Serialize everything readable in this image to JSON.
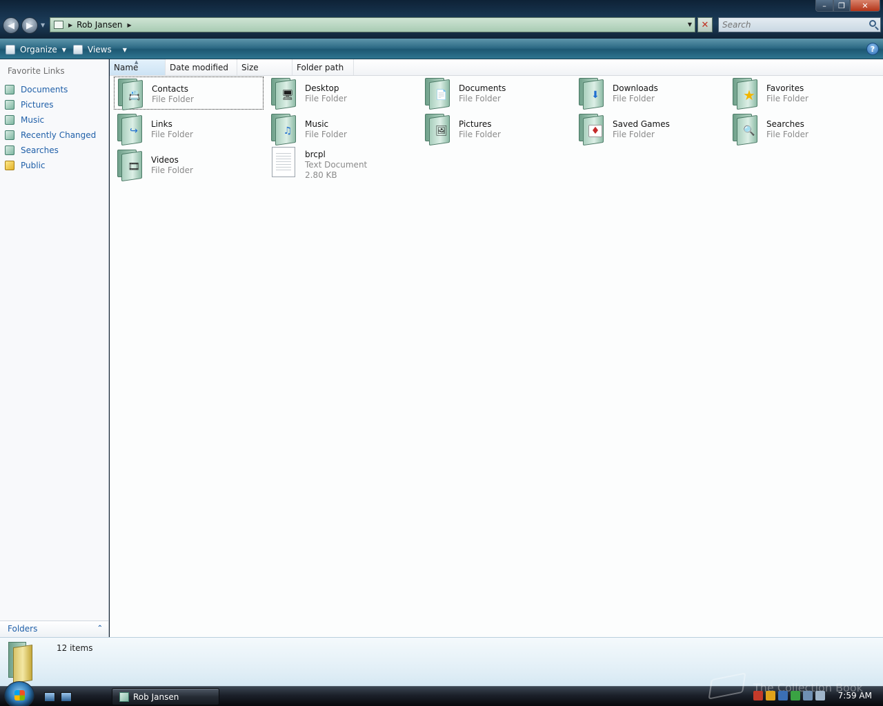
{
  "window": {
    "minimize": "–",
    "maximize": "❐",
    "close": "✕"
  },
  "navigation": {
    "back": "◀",
    "forward": "▶"
  },
  "address": {
    "path": "Rob Jansen",
    "refresh_glyph": "✕"
  },
  "search": {
    "placeholder": "Search"
  },
  "commandbar": {
    "organize": "Organize",
    "views": "Views",
    "help": "?"
  },
  "navpane": {
    "title": "Favorite Links",
    "links": [
      {
        "label": "Documents",
        "icon": "documents-icon"
      },
      {
        "label": "Pictures",
        "icon": "pictures-icon"
      },
      {
        "label": "Music",
        "icon": "music-icon"
      },
      {
        "label": "Recently Changed",
        "icon": "recently-changed-icon"
      },
      {
        "label": "Searches",
        "icon": "searches-icon"
      },
      {
        "label": "Public",
        "icon": "public-folder-icon"
      }
    ],
    "folders_label": "Folders"
  },
  "columns": [
    "Name",
    "Date modified",
    "Size",
    "Folder path"
  ],
  "items": [
    {
      "name": "Contacts",
      "type": "File Folder",
      "icon": "contacts-folder-icon",
      "badge": "📇"
    },
    {
      "name": "Desktop",
      "type": "File Folder",
      "icon": "desktop-folder-icon",
      "badge": "🖥"
    },
    {
      "name": "Documents",
      "type": "File Folder",
      "icon": "documents-folder-icon",
      "badge": "📄"
    },
    {
      "name": "Downloads",
      "type": "File Folder",
      "icon": "downloads-folder-icon",
      "badge": "⬇"
    },
    {
      "name": "Favorites",
      "type": "File Folder",
      "icon": "favorites-folder-icon",
      "badge": "★"
    },
    {
      "name": "Links",
      "type": "File Folder",
      "icon": "links-folder-icon",
      "badge": "↪"
    },
    {
      "name": "Music",
      "type": "File Folder",
      "icon": "music-folder-icon",
      "badge": "♫"
    },
    {
      "name": "Pictures",
      "type": "File Folder",
      "icon": "pictures-folder-icon",
      "badge": "🖼"
    },
    {
      "name": "Saved Games",
      "type": "File Folder",
      "icon": "saved-games-folder-icon",
      "badge": "♦"
    },
    {
      "name": "Searches",
      "type": "File Folder",
      "icon": "searches-folder-icon",
      "badge": "🔍"
    },
    {
      "name": "Videos",
      "type": "File Folder",
      "icon": "videos-folder-icon",
      "badge": "🎞"
    },
    {
      "name": "brcpl",
      "type": "Text Document",
      "size": "2.80 KB",
      "icon": "text-document-icon"
    }
  ],
  "details": {
    "count": "12 items"
  },
  "taskbar": {
    "task_label": "Rob Jansen",
    "clock": "7:59 AM",
    "watermark": "The Collection Book"
  },
  "colors": {
    "link": "#1f5fa8",
    "command_bar": "#2e6b86",
    "folder": "#a9cfbd"
  }
}
